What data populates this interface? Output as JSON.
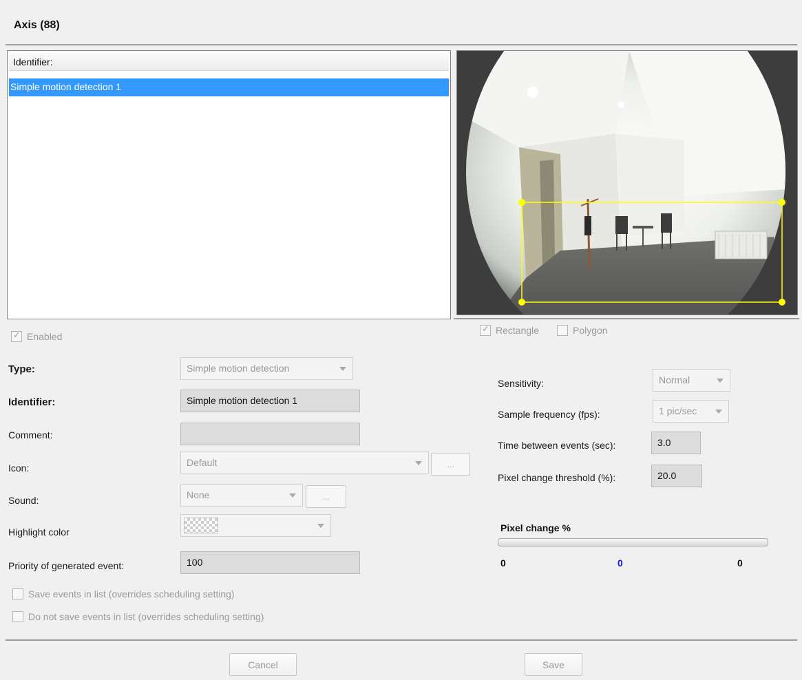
{
  "header": {
    "title": "Axis (88)"
  },
  "list": {
    "column_header": "Identifier:",
    "items": [
      "Simple motion detection 1"
    ]
  },
  "region": {
    "rectangle_label": "Rectangle",
    "polygon_label": "Polygon",
    "rectangle_checked": true,
    "polygon_checked": false,
    "zone_color": "#ffff00"
  },
  "form": {
    "enabled_label": "Enabled",
    "type_label": "Type:",
    "type_value": "Simple motion detection",
    "identifier_label": "Identifier:",
    "identifier_value": "Simple motion detection 1",
    "comment_label": "Comment:",
    "comment_value": "",
    "icon_label": "Icon:",
    "icon_value": "Default",
    "icon_browse": "...",
    "sound_label": "Sound:",
    "sound_value": "None",
    "sound_browse": "...",
    "highlight_label": "Highlight color",
    "priority_label": "Priority of generated event:",
    "priority_value": "100",
    "save_events_label": "Save events in list (overrides scheduling setting)",
    "no_save_events_label": "Do not save events in list (overrides scheduling setting)"
  },
  "settings": {
    "sensitivity_label": "Sensitivity:",
    "sensitivity_value": "Normal",
    "sample_freq_label": "Sample frequency (fps):",
    "sample_freq_value": "1 pic/sec",
    "time_between_label": "Time between events (sec):",
    "time_between_value": "3.0",
    "pixel_threshold_label": "Pixel change threshold (%):",
    "pixel_threshold_value": "20.0"
  },
  "pixel_change": {
    "title": "Pixel change %",
    "min": "0",
    "current": "0",
    "max": "0"
  },
  "actions": {
    "cancel": "Cancel",
    "save": "Save"
  }
}
